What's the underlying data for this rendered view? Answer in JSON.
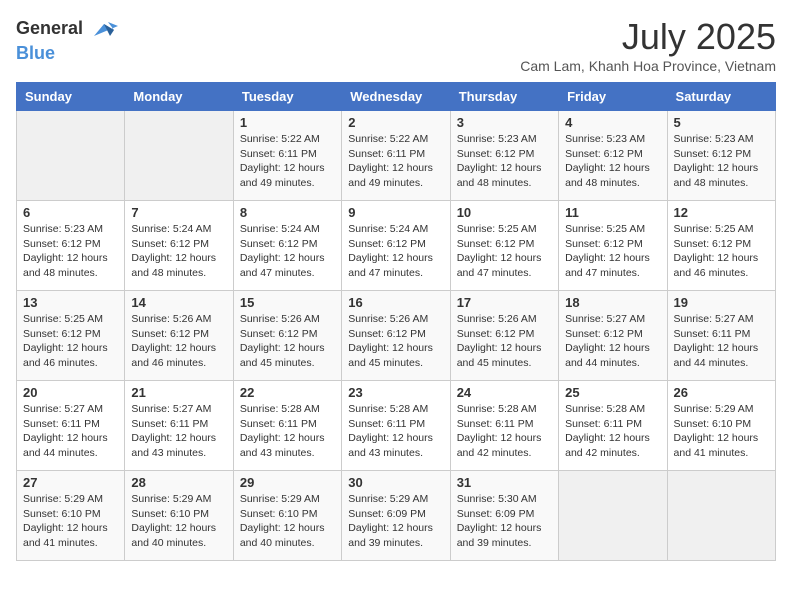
{
  "logo": {
    "text_general": "General",
    "text_blue": "Blue"
  },
  "title": "July 2025",
  "subtitle": "Cam Lam, Khanh Hoa Province, Vietnam",
  "days_of_week": [
    "Sunday",
    "Monday",
    "Tuesday",
    "Wednesday",
    "Thursday",
    "Friday",
    "Saturday"
  ],
  "weeks": [
    [
      {
        "day": "",
        "info": ""
      },
      {
        "day": "",
        "info": ""
      },
      {
        "day": "1",
        "info": "Sunrise: 5:22 AM\nSunset: 6:11 PM\nDaylight: 12 hours and 49 minutes."
      },
      {
        "day": "2",
        "info": "Sunrise: 5:22 AM\nSunset: 6:11 PM\nDaylight: 12 hours and 49 minutes."
      },
      {
        "day": "3",
        "info": "Sunrise: 5:23 AM\nSunset: 6:12 PM\nDaylight: 12 hours and 48 minutes."
      },
      {
        "day": "4",
        "info": "Sunrise: 5:23 AM\nSunset: 6:12 PM\nDaylight: 12 hours and 48 minutes."
      },
      {
        "day": "5",
        "info": "Sunrise: 5:23 AM\nSunset: 6:12 PM\nDaylight: 12 hours and 48 minutes."
      }
    ],
    [
      {
        "day": "6",
        "info": "Sunrise: 5:23 AM\nSunset: 6:12 PM\nDaylight: 12 hours and 48 minutes."
      },
      {
        "day": "7",
        "info": "Sunrise: 5:24 AM\nSunset: 6:12 PM\nDaylight: 12 hours and 48 minutes."
      },
      {
        "day": "8",
        "info": "Sunrise: 5:24 AM\nSunset: 6:12 PM\nDaylight: 12 hours and 47 minutes."
      },
      {
        "day": "9",
        "info": "Sunrise: 5:24 AM\nSunset: 6:12 PM\nDaylight: 12 hours and 47 minutes."
      },
      {
        "day": "10",
        "info": "Sunrise: 5:25 AM\nSunset: 6:12 PM\nDaylight: 12 hours and 47 minutes."
      },
      {
        "day": "11",
        "info": "Sunrise: 5:25 AM\nSunset: 6:12 PM\nDaylight: 12 hours and 47 minutes."
      },
      {
        "day": "12",
        "info": "Sunrise: 5:25 AM\nSunset: 6:12 PM\nDaylight: 12 hours and 46 minutes."
      }
    ],
    [
      {
        "day": "13",
        "info": "Sunrise: 5:25 AM\nSunset: 6:12 PM\nDaylight: 12 hours and 46 minutes."
      },
      {
        "day": "14",
        "info": "Sunrise: 5:26 AM\nSunset: 6:12 PM\nDaylight: 12 hours and 46 minutes."
      },
      {
        "day": "15",
        "info": "Sunrise: 5:26 AM\nSunset: 6:12 PM\nDaylight: 12 hours and 45 minutes."
      },
      {
        "day": "16",
        "info": "Sunrise: 5:26 AM\nSunset: 6:12 PM\nDaylight: 12 hours and 45 minutes."
      },
      {
        "day": "17",
        "info": "Sunrise: 5:26 AM\nSunset: 6:12 PM\nDaylight: 12 hours and 45 minutes."
      },
      {
        "day": "18",
        "info": "Sunrise: 5:27 AM\nSunset: 6:12 PM\nDaylight: 12 hours and 44 minutes."
      },
      {
        "day": "19",
        "info": "Sunrise: 5:27 AM\nSunset: 6:11 PM\nDaylight: 12 hours and 44 minutes."
      }
    ],
    [
      {
        "day": "20",
        "info": "Sunrise: 5:27 AM\nSunset: 6:11 PM\nDaylight: 12 hours and 44 minutes."
      },
      {
        "day": "21",
        "info": "Sunrise: 5:27 AM\nSunset: 6:11 PM\nDaylight: 12 hours and 43 minutes."
      },
      {
        "day": "22",
        "info": "Sunrise: 5:28 AM\nSunset: 6:11 PM\nDaylight: 12 hours and 43 minutes."
      },
      {
        "day": "23",
        "info": "Sunrise: 5:28 AM\nSunset: 6:11 PM\nDaylight: 12 hours and 43 minutes."
      },
      {
        "day": "24",
        "info": "Sunrise: 5:28 AM\nSunset: 6:11 PM\nDaylight: 12 hours and 42 minutes."
      },
      {
        "day": "25",
        "info": "Sunrise: 5:28 AM\nSunset: 6:11 PM\nDaylight: 12 hours and 42 minutes."
      },
      {
        "day": "26",
        "info": "Sunrise: 5:29 AM\nSunset: 6:10 PM\nDaylight: 12 hours and 41 minutes."
      }
    ],
    [
      {
        "day": "27",
        "info": "Sunrise: 5:29 AM\nSunset: 6:10 PM\nDaylight: 12 hours and 41 minutes."
      },
      {
        "day": "28",
        "info": "Sunrise: 5:29 AM\nSunset: 6:10 PM\nDaylight: 12 hours and 40 minutes."
      },
      {
        "day": "29",
        "info": "Sunrise: 5:29 AM\nSunset: 6:10 PM\nDaylight: 12 hours and 40 minutes."
      },
      {
        "day": "30",
        "info": "Sunrise: 5:29 AM\nSunset: 6:09 PM\nDaylight: 12 hours and 39 minutes."
      },
      {
        "day": "31",
        "info": "Sunrise: 5:30 AM\nSunset: 6:09 PM\nDaylight: 12 hours and 39 minutes."
      },
      {
        "day": "",
        "info": ""
      },
      {
        "day": "",
        "info": ""
      }
    ]
  ]
}
